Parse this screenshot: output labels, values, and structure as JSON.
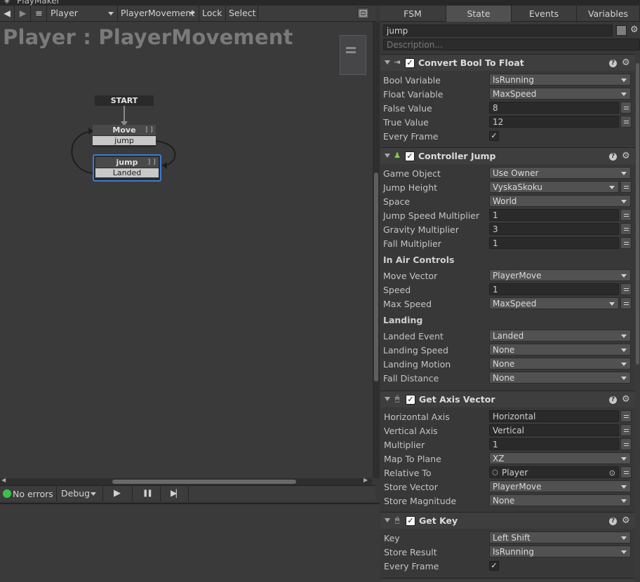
{
  "window": {
    "title": "PlayMaker"
  },
  "toolbar": {
    "back": "◀",
    "forward": "▶",
    "menu": "≡",
    "gameobject": "Player",
    "fsm": "PlayerMovement",
    "lock": "Lock",
    "select": "Select"
  },
  "graph": {
    "title": "Player : PlayerMovement",
    "start_label": "START",
    "states": [
      {
        "name": "Move",
        "transition": "jump"
      },
      {
        "name": "jump",
        "transition": "Landed"
      }
    ]
  },
  "bottom": {
    "status": "No errors",
    "debug": "Debug",
    "play": "▶",
    "pause": "❚❚",
    "step": "▶|"
  },
  "tabs": [
    "FSM",
    "State",
    "Events",
    "Variables"
  ],
  "state": {
    "name": "jump",
    "description_placeholder": "Description..."
  },
  "actions": {
    "convert_bool": {
      "title": "Convert Bool To Float",
      "rows": {
        "bool_var": {
          "label": "Bool Variable",
          "value": "IsRunning"
        },
        "float_var": {
          "label": "Float Variable",
          "value": "MaxSpeed"
        },
        "false_val": {
          "label": "False Value",
          "value": "8"
        },
        "true_val": {
          "label": "True Value",
          "value": "12"
        },
        "every_frame": {
          "label": "Every Frame",
          "checked": "✓"
        }
      }
    },
    "controller_jump": {
      "title": "Controller Jump",
      "rows": {
        "game_object": {
          "label": "Game Object",
          "value": "Use Owner"
        },
        "jump_height": {
          "label": "Jump Height",
          "value": "VyskaSkoku"
        },
        "space": {
          "label": "Space",
          "value": "World"
        },
        "jump_speed_mult": {
          "label": "Jump Speed Multiplier",
          "value": "1"
        },
        "gravity_mult": {
          "label": "Gravity Multiplier",
          "value": "3"
        },
        "fall_mult": {
          "label": "Fall Multiplier",
          "value": "1"
        },
        "in_air_header": "In Air Controls",
        "move_vector": {
          "label": "Move Vector",
          "value": "PlayerMove"
        },
        "speed": {
          "label": "Speed",
          "value": "1"
        },
        "max_speed": {
          "label": "Max Speed",
          "value": "MaxSpeed"
        },
        "landing_header": "Landing",
        "landed_event": {
          "label": "Landed Event",
          "value": "Landed"
        },
        "landing_speed": {
          "label": "Landing Speed",
          "value": "None"
        },
        "landing_motion": {
          "label": "Landing Motion",
          "value": "None"
        },
        "fall_distance": {
          "label": "Fall Distance",
          "value": "None"
        }
      }
    },
    "get_axis_vector": {
      "title": "Get Axis Vector",
      "rows": {
        "horizontal_axis": {
          "label": "Horizontal Axis",
          "value": "Horizontal"
        },
        "vertical_axis": {
          "label": "Vertical Axis",
          "value": "Vertical"
        },
        "multiplier": {
          "label": "Multiplier",
          "value": "1"
        },
        "map_to_plane": {
          "label": "Map To Plane",
          "value": "XZ"
        },
        "relative_to": {
          "label": "Relative To",
          "value": "Player"
        },
        "store_vector": {
          "label": "Store Vector",
          "value": "PlayerMove"
        },
        "store_magnitude": {
          "label": "Store Magnitude",
          "value": "None"
        }
      }
    },
    "get_key": {
      "title": "Get Key",
      "rows": {
        "key": {
          "label": "Key",
          "value": "Left Shift"
        },
        "store_result": {
          "label": "Store Result",
          "value": "IsRunning"
        },
        "every_frame": {
          "label": "Every Frame",
          "checked": "✓"
        }
      }
    }
  },
  "colors": {
    "accent": "#3a7bd5",
    "status_ok": "#3cc24a",
    "action_icon": "#7bd14a"
  }
}
